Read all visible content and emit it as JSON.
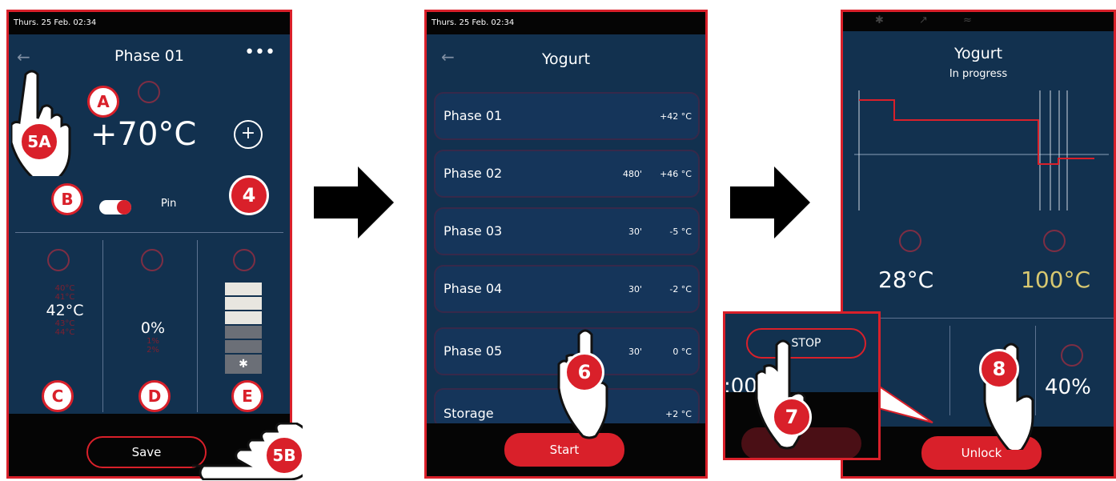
{
  "screen1": {
    "status_time": "Thurs. 25 Feb. 02:34",
    "title": "Phase 01",
    "temperature": "+70°C",
    "pin_label": "Pin",
    "probe_values": [
      "40°C",
      "41°C",
      "42°C",
      "43°C",
      "44°C"
    ],
    "humidity_values": [
      "0%",
      "1%",
      "2%"
    ],
    "save_label": "Save"
  },
  "screen2": {
    "status_time": "Thurs. 25 Feb. 02:34",
    "title": "Yogurt",
    "phases": [
      {
        "name": "Phase 01",
        "duration": "",
        "temp": "+42 °C"
      },
      {
        "name": "Phase 02",
        "duration": "480'",
        "temp": "+46 °C"
      },
      {
        "name": "Phase 03",
        "duration": "30'",
        "temp": "-5 °C"
      },
      {
        "name": "Phase 04",
        "duration": "30'",
        "temp": "-2 °C"
      },
      {
        "name": "Phase 05",
        "duration": "30'",
        "temp": "0 °C"
      },
      {
        "name": "Storage",
        "duration": "",
        "temp": "+2 °C"
      }
    ],
    "start_label": "Start"
  },
  "screen3": {
    "title": "Yogurt",
    "subtitle": "In progress",
    "chamber_temp": "28°C",
    "probe_temp": "100°C",
    "timer": ":00",
    "fan": "40%",
    "unlock_label": "Unlock",
    "stop_label": "STOP"
  },
  "callouts": {
    "A": "A",
    "B": "B",
    "C": "C",
    "D": "D",
    "E": "E",
    "four": "4",
    "fiveA": "5A",
    "fiveB": "5B",
    "six": "6",
    "seven": "7",
    "eight": "8"
  },
  "colors": {
    "accent": "#d9202a",
    "screen_bg": "#12314f",
    "topbar": "#050505",
    "probe_color": "#d8c870"
  }
}
